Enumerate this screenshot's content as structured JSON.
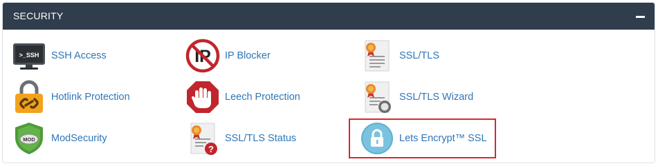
{
  "section": {
    "title": "SECURITY",
    "collapse_icon": "minus-icon"
  },
  "items": [
    {
      "label": "SSH Access",
      "icon": "ssh-terminal-icon"
    },
    {
      "label": "IP Blocker",
      "icon": "ip-blocker-icon"
    },
    {
      "label": "SSL/TLS",
      "icon": "certificate-icon"
    },
    {
      "label": "Hotlink Protection",
      "icon": "padlock-chain-icon"
    },
    {
      "label": "Leech Protection",
      "icon": "stop-hand-icon"
    },
    {
      "label": "SSL/TLS Wizard",
      "icon": "certificate-wizard-icon"
    },
    {
      "label": "ModSecurity",
      "icon": "mod-shield-icon"
    },
    {
      "label": "SSL/TLS Status",
      "icon": "certificate-status-icon"
    },
    {
      "label": "Lets Encrypt™ SSL",
      "icon": "lock-circle-icon"
    }
  ],
  "icon_text": {
    "ssh": ">_SSH",
    "ip": "IP",
    "mod": "MOD",
    "status_mark": "?"
  },
  "colors": {
    "header_bg": "#2f3d4c",
    "link": "#2f76b7",
    "highlight_border": "#d9262c"
  }
}
